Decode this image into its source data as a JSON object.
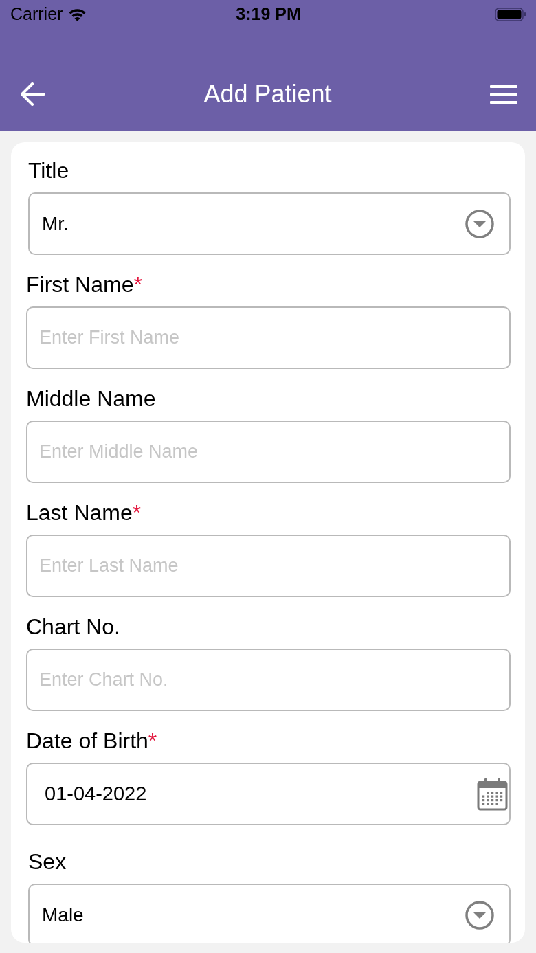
{
  "status_bar": {
    "carrier": "Carrier",
    "time": "3:19 PM"
  },
  "header": {
    "title": "Add Patient"
  },
  "form": {
    "fields": [
      {
        "kind": "select",
        "label": "Title",
        "value": "Mr."
      },
      {
        "kind": "text",
        "label": "First Name",
        "required_mark": "*",
        "placeholder": "Enter First Name"
      },
      {
        "kind": "text",
        "label": "Middle Name",
        "placeholder": "Enter Middle Name"
      },
      {
        "kind": "text",
        "label": "Last Name",
        "required_mark": "*",
        "placeholder": "Enter Last Name"
      },
      {
        "kind": "text",
        "label": "Chart No.",
        "placeholder": "Enter Chart No."
      },
      {
        "kind": "date",
        "label": "Date of Birth",
        "required_mark": "*",
        "value": "01-04-2022"
      },
      {
        "kind": "select",
        "label": "Sex",
        "value": "Male"
      }
    ]
  }
}
